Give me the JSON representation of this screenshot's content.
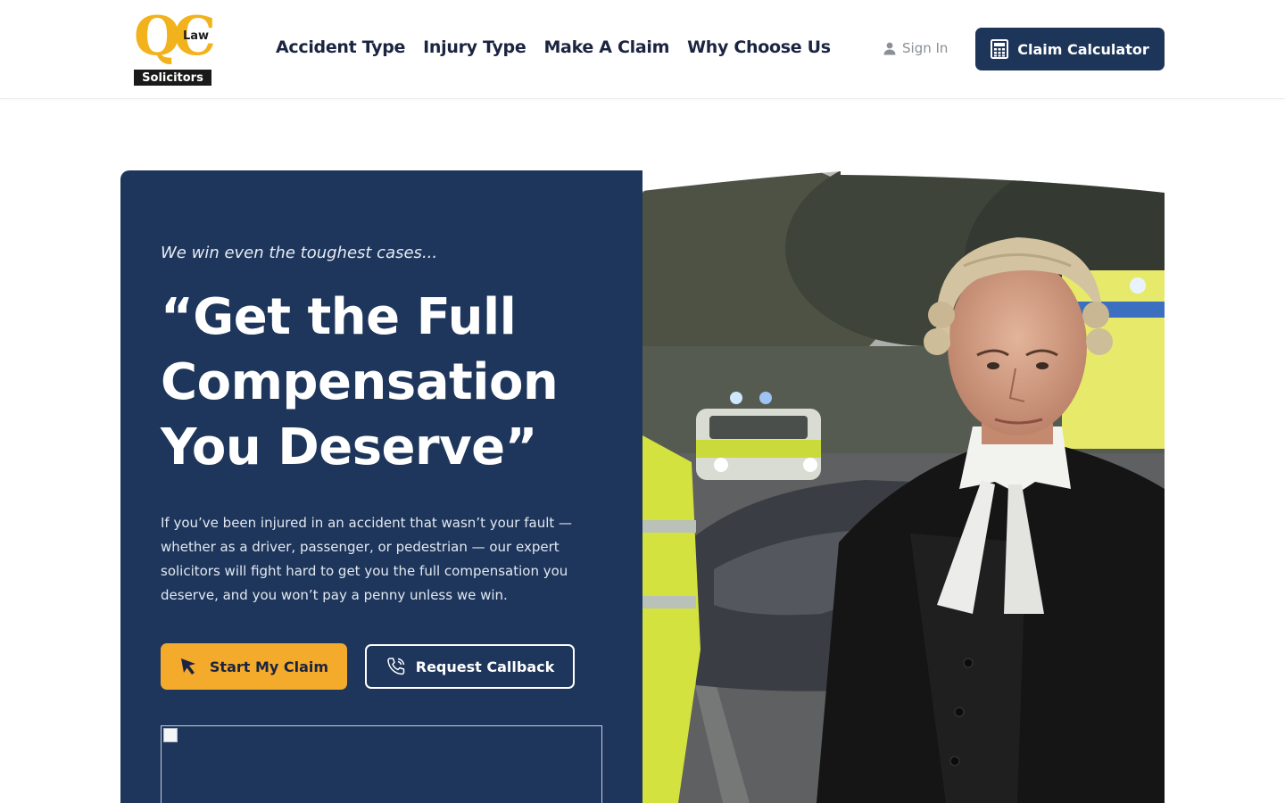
{
  "brand": {
    "logo_qc": "QC",
    "logo_law": "Law",
    "logo_solicitors": "Solicitors",
    "accent_color": "#f4ab2c",
    "navy_color": "#1e365b"
  },
  "nav": {
    "items": [
      {
        "label": "Accident Type"
      },
      {
        "label": "Injury Type"
      },
      {
        "label": "Make A Claim"
      },
      {
        "label": "Why Choose Us"
      }
    ],
    "signin_label": "Sign In",
    "signin_icon": "user-icon",
    "calculator_label": "Claim Calculator",
    "calculator_icon": "calculator-icon"
  },
  "hero": {
    "tagline": "We win even the toughest cases...",
    "headline": "“Get the Full Compensation You Deserve”",
    "intro": "If you’ve been injured in an accident that wasn’t your fault — whether as a driver, passenger, or pedestrian — our expert solicitors will fight hard to get you the full compensation you deserve, and you won’t pay a penny unless we win.",
    "primary_button": "Start My Claim",
    "primary_icon": "cursor-arrow-icon",
    "secondary_button": "Request Callback",
    "secondary_icon": "phone-icon",
    "photo_subject": "barrister-at-accident-scene"
  }
}
